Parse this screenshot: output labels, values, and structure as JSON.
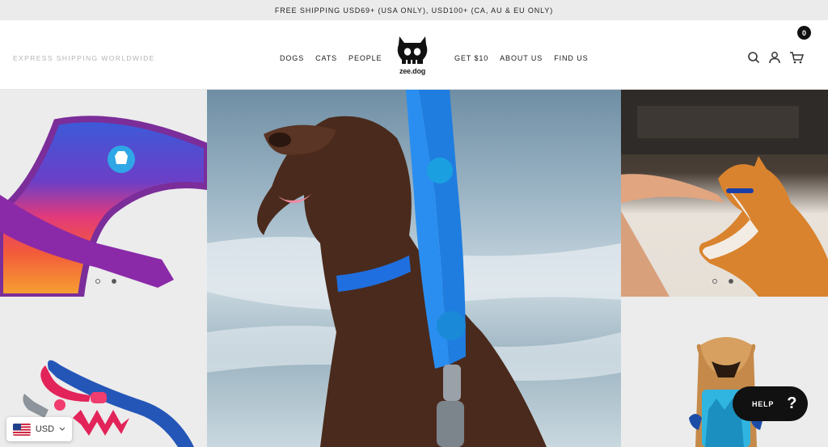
{
  "announcement": {
    "text": "FREE SHIPPING USD69+ (USA ONLY), USD100+ (CA, AU & EU ONLY)"
  },
  "header": {
    "tagline": "EXPRESS SHIPPING WORLDWIDE",
    "nav_left": [
      {
        "label": "DOGS"
      },
      {
        "label": "CATS"
      },
      {
        "label": "PEOPLE"
      }
    ],
    "nav_right": [
      {
        "label": "GET $10"
      },
      {
        "label": "ABOUT US"
      },
      {
        "label": "FIND US"
      }
    ],
    "logo_text": "zee.dog",
    "cart_count": "0",
    "icons": {
      "search": "search-icon",
      "account": "user-icon",
      "cart": "cart-icon"
    }
  },
  "tiles": [
    {
      "subject": "harness-image",
      "dots": 2,
      "active_dot": 1
    },
    {
      "subject": "dog-leash-image"
    },
    {
      "subject": "cat-image",
      "dots": 2,
      "active_dot": 1
    },
    {
      "subject": "leash-image"
    },
    {
      "subject": "toy-image"
    }
  ],
  "currency": {
    "code": "USD",
    "flag": "us-flag-icon"
  },
  "help": {
    "label": "HELP",
    "symbol": "?"
  },
  "colors": {
    "announcement_bg": "#ebebeb",
    "help_bg": "#111111",
    "accent_blue": "#1f7de0"
  }
}
